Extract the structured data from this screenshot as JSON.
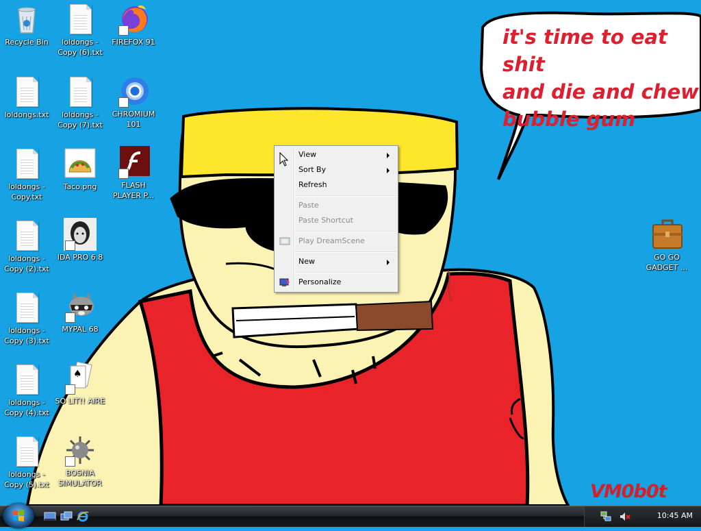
{
  "wallpaper": {
    "speech_bubble_text": "it's time to eat shit\nand die and chew\nbubble gum",
    "signature": "VM0b0t"
  },
  "desktop_icons": [
    {
      "label": "Recycle Bin",
      "icon": "recycle-bin-icon"
    },
    {
      "label": "loldongs - Copy (6).txt",
      "icon": "text-file-icon"
    },
    {
      "label": "FIREFOX 91",
      "icon": "firefox-icon"
    },
    {
      "label": "loldongs.txt",
      "icon": "text-file-icon"
    },
    {
      "label": "loldongs - Copy (7).txt",
      "icon": "text-file-icon"
    },
    {
      "label": "CHROMIUM 101",
      "icon": "chromium-icon"
    },
    {
      "label": "loldongs - Copy.txt",
      "icon": "text-file-icon"
    },
    {
      "label": "Taco.png",
      "icon": "taco-image-icon"
    },
    {
      "label": "FLASH PLAYER P...",
      "icon": "flash-player-icon"
    },
    {
      "label": "loldongs - Copy (2).txt",
      "icon": "text-file-icon"
    },
    {
      "label": "IDA PRO 6.8",
      "icon": "ida-pro-icon"
    },
    {
      "label": "loldongs - Copy (3).txt",
      "icon": "text-file-icon"
    },
    {
      "label": "MYPAL 68",
      "icon": "mypal-raccoon-icon"
    },
    {
      "label": "loldongs - Copy (4).txt",
      "icon": "text-file-icon"
    },
    {
      "label": "SO LIT!! AIRE",
      "icon": "solitaire-icon"
    },
    {
      "label": "loldongs - Copy (5).txt",
      "icon": "text-file-icon"
    },
    {
      "label": "BOSNIA SIMULATOR",
      "icon": "minesweeper-mine-icon"
    },
    {
      "label": "GO GO GADGET ...",
      "icon": "briefcase-icon"
    }
  ],
  "context_menu": {
    "items": [
      {
        "label": "View",
        "submenu": true,
        "enabled": true
      },
      {
        "label": "Sort By",
        "submenu": true,
        "enabled": true
      },
      {
        "label": "Refresh",
        "submenu": false,
        "enabled": true
      },
      {
        "label": "Paste",
        "submenu": false,
        "enabled": false
      },
      {
        "label": "Paste Shortcut",
        "submenu": false,
        "enabled": false
      },
      {
        "label": "Play DreamScene",
        "submenu": false,
        "enabled": false,
        "icon": "dreamscene-icon"
      },
      {
        "label": "New",
        "submenu": true,
        "enabled": true
      },
      {
        "label": "Personalize",
        "submenu": false,
        "enabled": true,
        "icon": "personalize-icon"
      }
    ]
  },
  "taskbar": {
    "quick_launch": [
      "show-desktop-icon",
      "switch-windows-icon",
      "internet-explorer-icon"
    ],
    "tray_icons": [
      "network-icon",
      "volume-muted-icon"
    ],
    "clock": "10:45 AM"
  },
  "colors": {
    "desktop_background": "#16a2e3",
    "bubble_text": "#dc2030",
    "hat": "#fde62b",
    "shirt": "#e8232a",
    "skin": "#fbf3b3"
  }
}
